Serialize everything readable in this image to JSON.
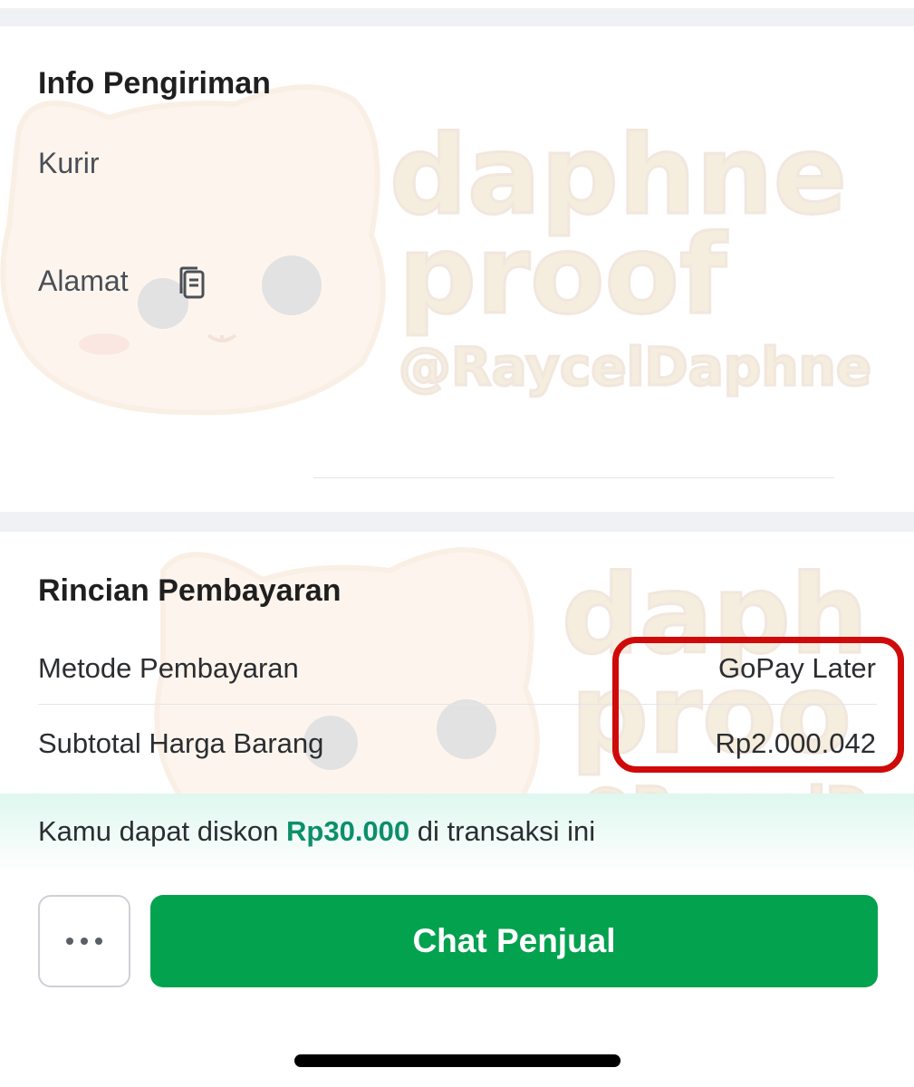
{
  "shipping": {
    "title": "Info Pengiriman",
    "courier_label": "Kurir",
    "address_label": "Alamat"
  },
  "payment": {
    "title": "Rincian Pembayaran",
    "method_label": "Metode Pembayaran",
    "method_value": "GoPay Later",
    "subtotal_label": "Subtotal Harga Barang",
    "subtotal_value": "Rp2.000.042"
  },
  "discount": {
    "prefix": "Kamu dapat diskon ",
    "amount": "Rp30.000",
    "suffix": " di transaksi ini"
  },
  "actions": {
    "more_icon": "more-horizontal-icon",
    "chat_label": "Chat Penjual"
  },
  "icons": {
    "address": "copy-icon"
  },
  "colors": {
    "accent_green": "#03a24e",
    "discount_green": "#0b8f6a",
    "highlight_red": "#d00a0a"
  },
  "watermark": {
    "line1": "daphne",
    "line2": "proof",
    "line3": "@RaycelDaphne"
  }
}
